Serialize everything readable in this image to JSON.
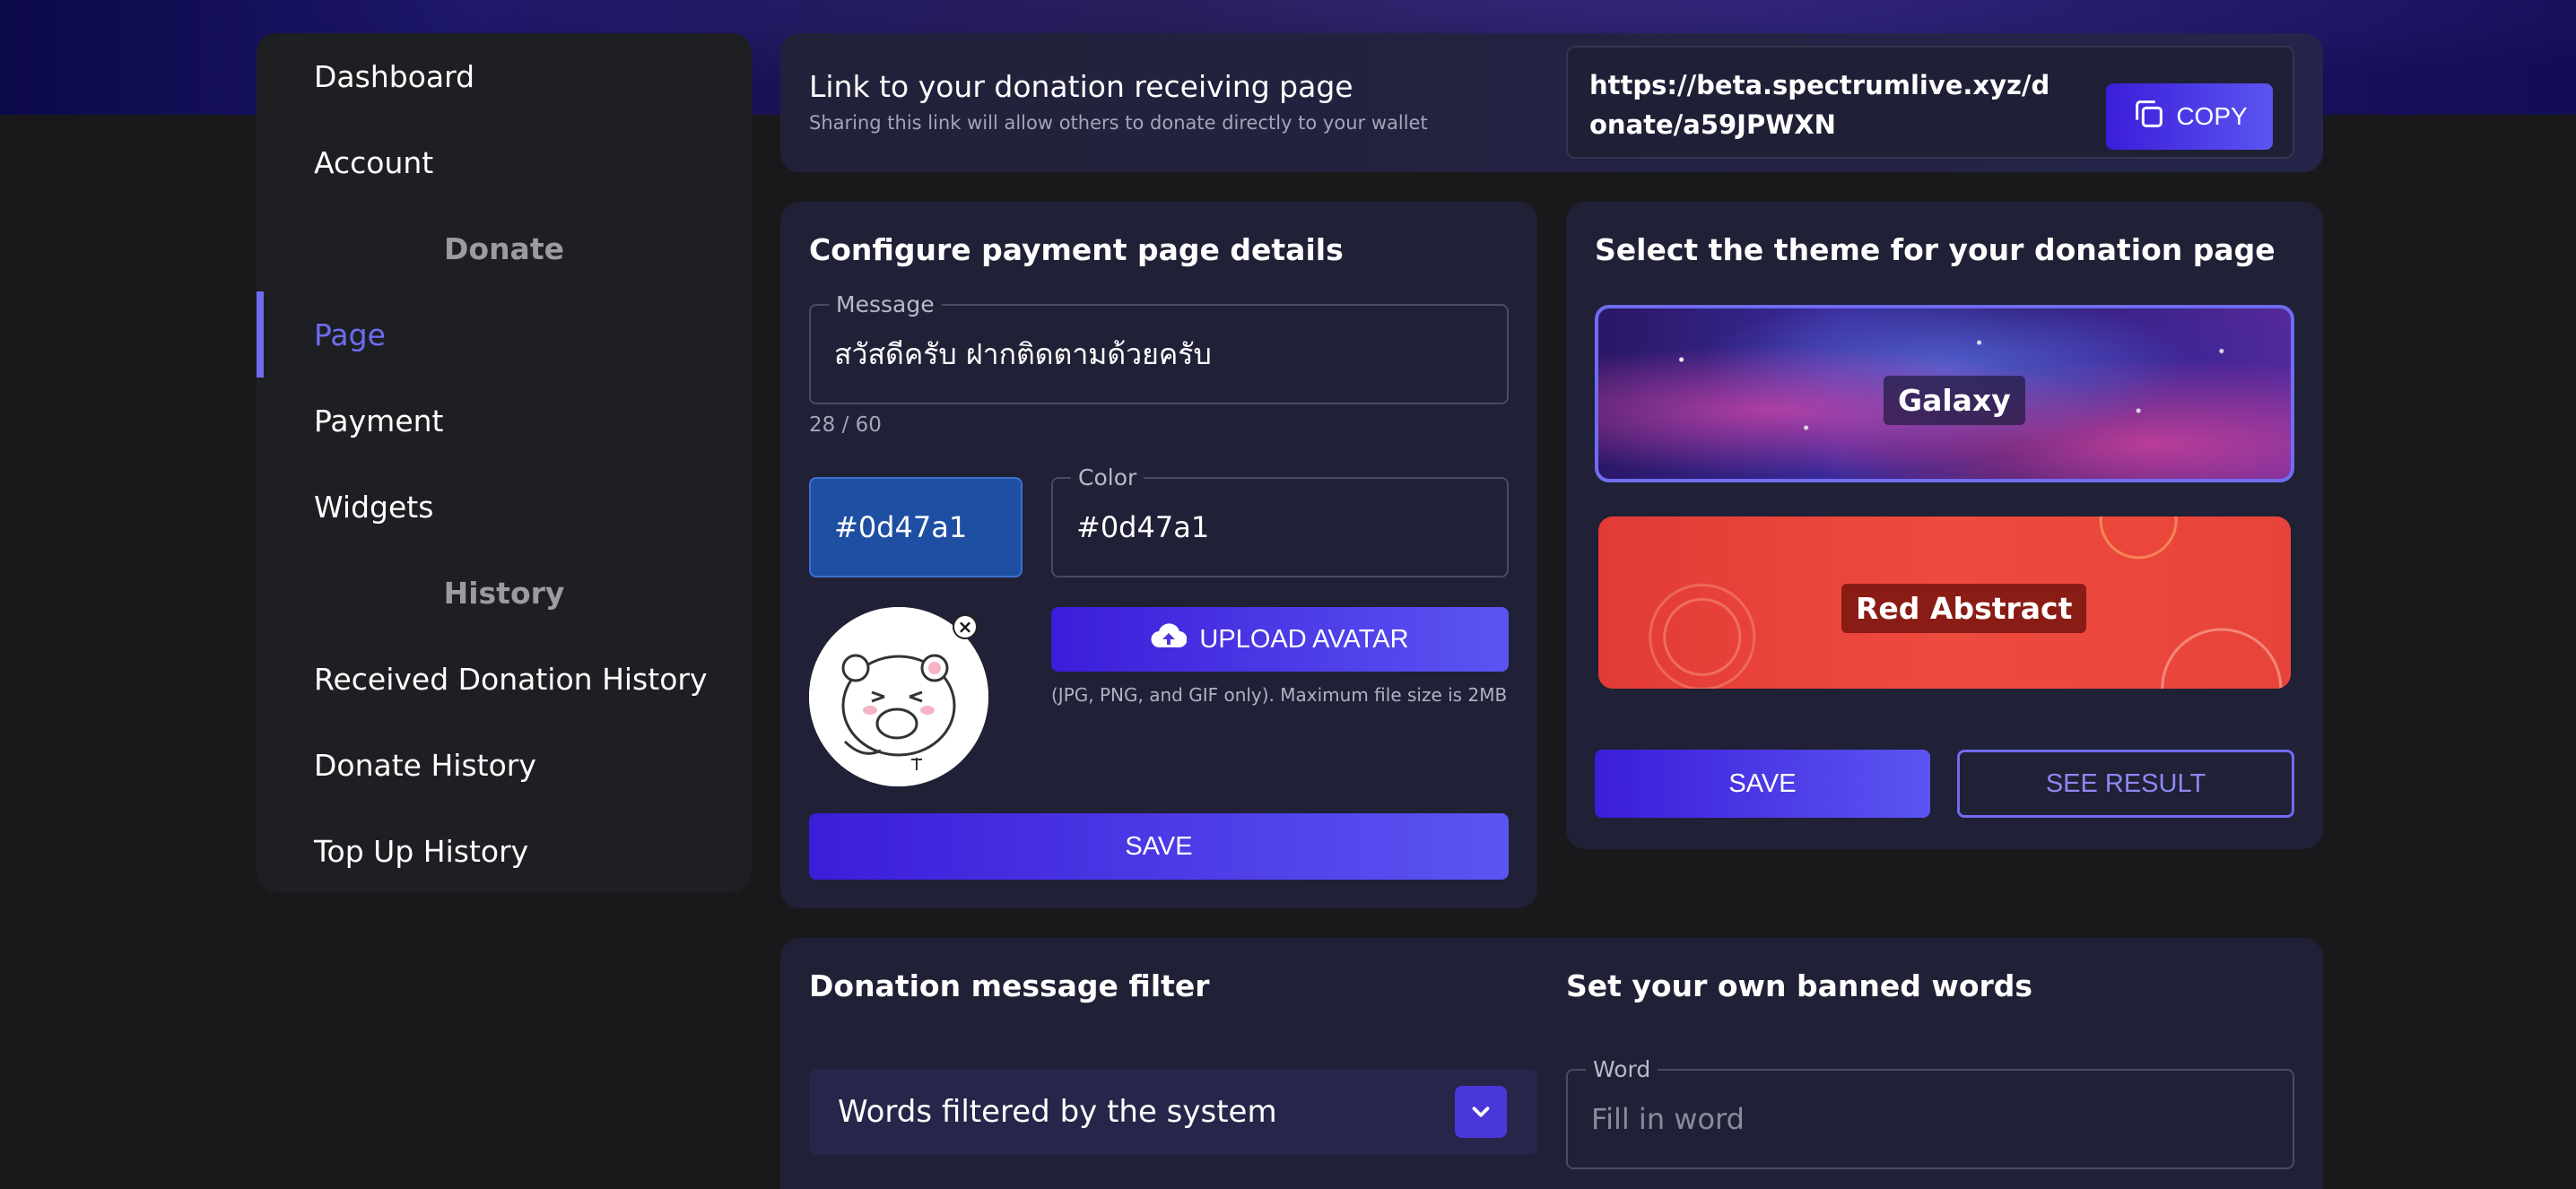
{
  "sidebar": {
    "items": [
      {
        "label": "Dashboard"
      },
      {
        "label": "Account"
      },
      {
        "section": "Donate"
      },
      {
        "label": "Page",
        "active": true
      },
      {
        "label": "Payment"
      },
      {
        "label": "Widgets"
      },
      {
        "section": "History"
      },
      {
        "label": "Received Donation History"
      },
      {
        "label": "Donate History"
      },
      {
        "label": "Top Up History"
      }
    ]
  },
  "link_card": {
    "title": "Link to your donation receiving page",
    "subtitle": "Sharing this link will allow others to donate directly to your wallet",
    "url": "https://beta.spectrumlive.xyz/donate/a59JPWXN",
    "copy_label": "COPY",
    "copy_icon": "copy-icon"
  },
  "config": {
    "title": "Configure payment page details",
    "message_label": "Message",
    "message_value": "สวัสดีครับ ฝากติดตามด้วยครับ",
    "message_counter": "28 / 60",
    "color_swatch": "#0d47a1",
    "color_label": "Color",
    "color_value": "#0d47a1",
    "upload_label": "UPLOAD AVATAR",
    "upload_icon": "cloud-upload-icon",
    "upload_hint": "(JPG, PNG, and GIF only). Maximum file size is 2MB",
    "remove_avatar": "×",
    "save_label": "SAVE"
  },
  "theme": {
    "title": "Select the theme for your donation page",
    "options": [
      {
        "name": "Galaxy",
        "selected": true
      },
      {
        "name": "Red Abstract",
        "selected": false
      }
    ],
    "save_label": "SAVE",
    "see_result_label": "SEE RESULT"
  },
  "filter": {
    "title": "Donation message filter",
    "select_label": "Words filtered by the system",
    "banned_title": "Set your own banned words",
    "word_label": "Word",
    "word_placeholder": "Fill in word"
  },
  "colors": {
    "accent": "#6f6cf0",
    "button_gradient_start": "#3b1dd9",
    "button_gradient_end": "#5b55f2",
    "background": "#19191c"
  }
}
